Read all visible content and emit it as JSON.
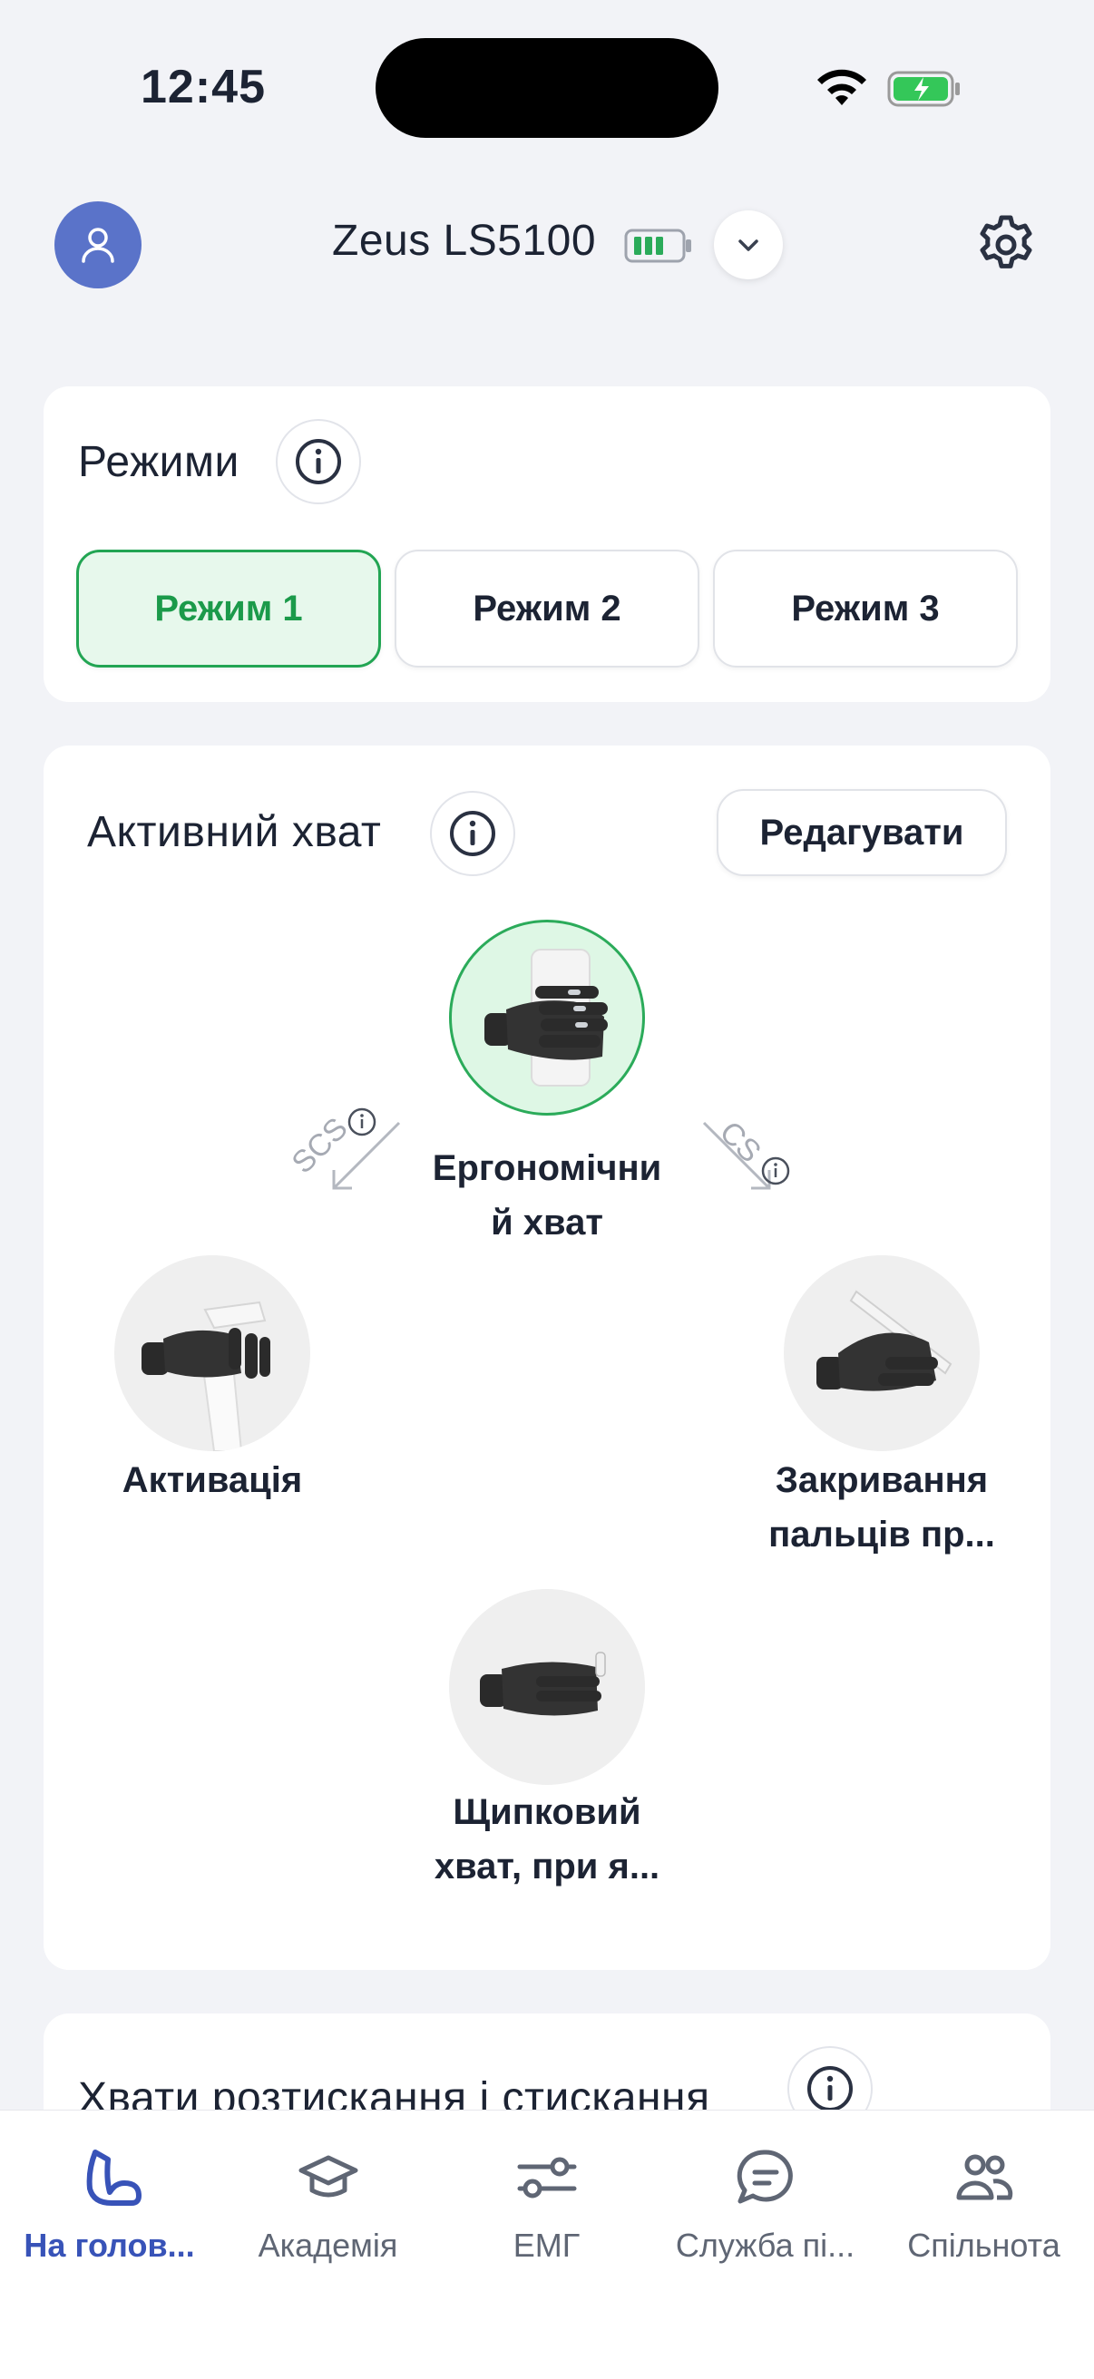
{
  "status_bar": {
    "time": "12:45"
  },
  "header": {
    "device_name": "Zeus LS5100"
  },
  "modes_card": {
    "title": "Режими",
    "modes": [
      "Режим 1",
      "Режим 2",
      "Режим 3"
    ],
    "active_index": 0
  },
  "grip_card": {
    "title": "Активний хват",
    "edit_label": "Редагувати",
    "center": {
      "line1": "Ергономічни",
      "line2": "й хват"
    },
    "left": {
      "line1": "Активація"
    },
    "right": {
      "line1": "Закривання",
      "line2": "пальців пр..."
    },
    "bottom": {
      "line1": "Щипковий",
      "line2": "хват, при я..."
    },
    "left_arrow_label": "SCS",
    "right_arrow_label": "CS"
  },
  "squeeze_card": {
    "title": "Хвати розтискання і стискання"
  },
  "tabbar": {
    "tabs": [
      "На голов...",
      "Академія",
      "ЕМГ",
      "Служба пі...",
      "Спільнота"
    ],
    "active_index": 0
  },
  "colors": {
    "accent_green": "#22a553",
    "brand_blue": "#3853b8",
    "avatar_blue": "#5a73c9",
    "background": "#f2f3f7"
  }
}
